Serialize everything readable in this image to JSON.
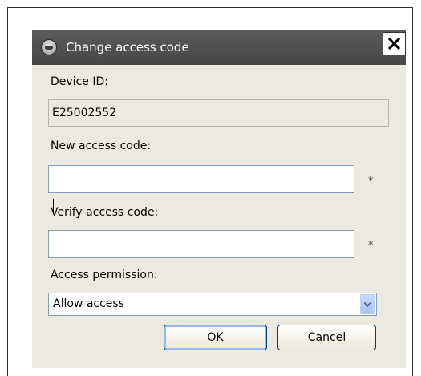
{
  "dialog": {
    "title": "Change access code",
    "close_symbol": "×"
  },
  "device_id": {
    "label": "Device ID:",
    "value": "E25002552"
  },
  "new_code": {
    "label": "New access code:",
    "value": "",
    "required_mark": "*"
  },
  "verify_code": {
    "label": "Verify access code:",
    "value": "",
    "required_mark": "*"
  },
  "permission": {
    "label": "Access permission:",
    "selected": "Allow access"
  },
  "buttons": {
    "ok": "OK",
    "cancel": "Cancel"
  },
  "icons": {
    "app": "app-icon",
    "close": "close-icon",
    "dropdown": "chevron-down-icon"
  },
  "colors": {
    "titlebar": "#505050",
    "dialog_background": "#ece9e1",
    "input_border": "#7f9db9",
    "button_border": "#003c74",
    "dropdown_arrow": "#4d6185"
  }
}
